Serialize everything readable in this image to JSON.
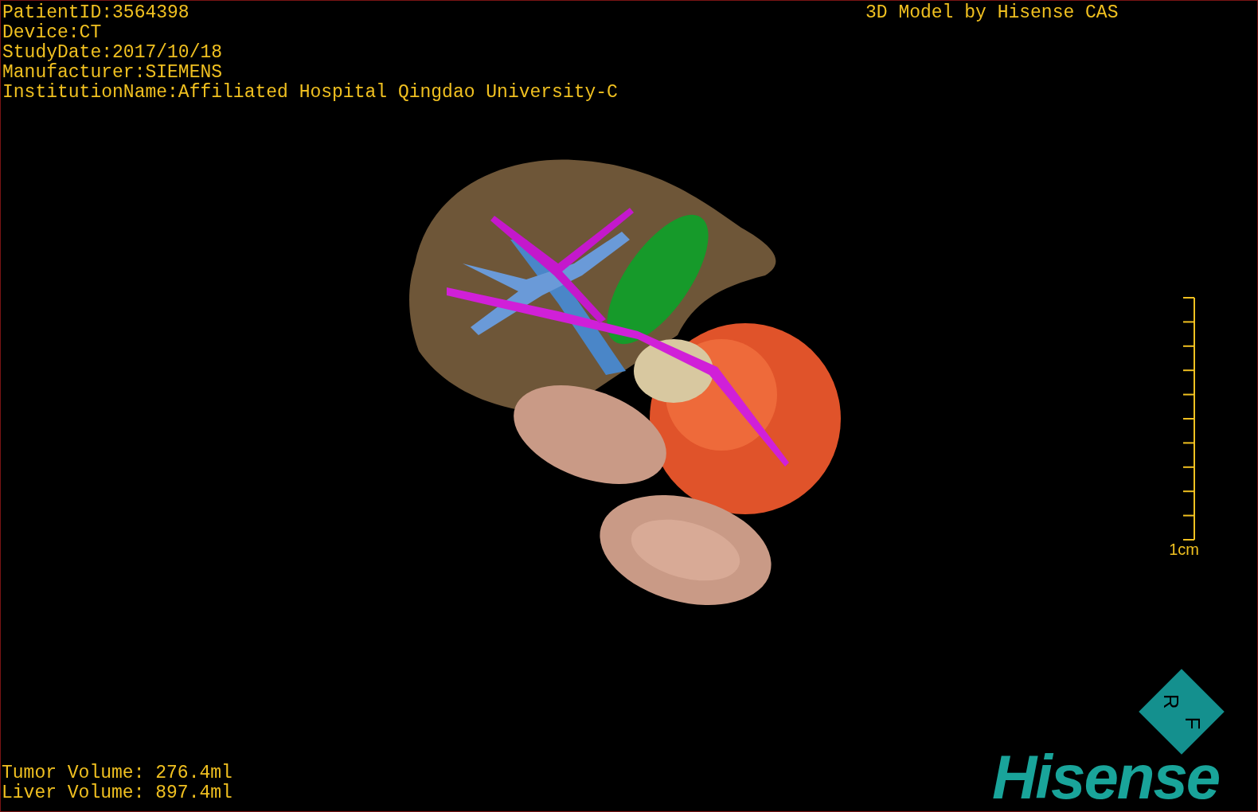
{
  "patient_info": [
    "PatientID:3564398",
    "Device:CT",
    "StudyDate:2017/10/18",
    "Manufacturer:SIEMENS",
    "InstitutionName:Affiliated Hospital Qingdao University-C"
  ],
  "model_credit": "3D Model by Hisense CAS",
  "scale_bar": {
    "label": "1cm"
  },
  "volumes": [
    "Tumor Volume: 276.4ml",
    "Liver Volume: 897.4ml"
  ],
  "orientation_marker": {
    "labels": [
      "R",
      "F"
    ]
  },
  "logo": "Hisense"
}
